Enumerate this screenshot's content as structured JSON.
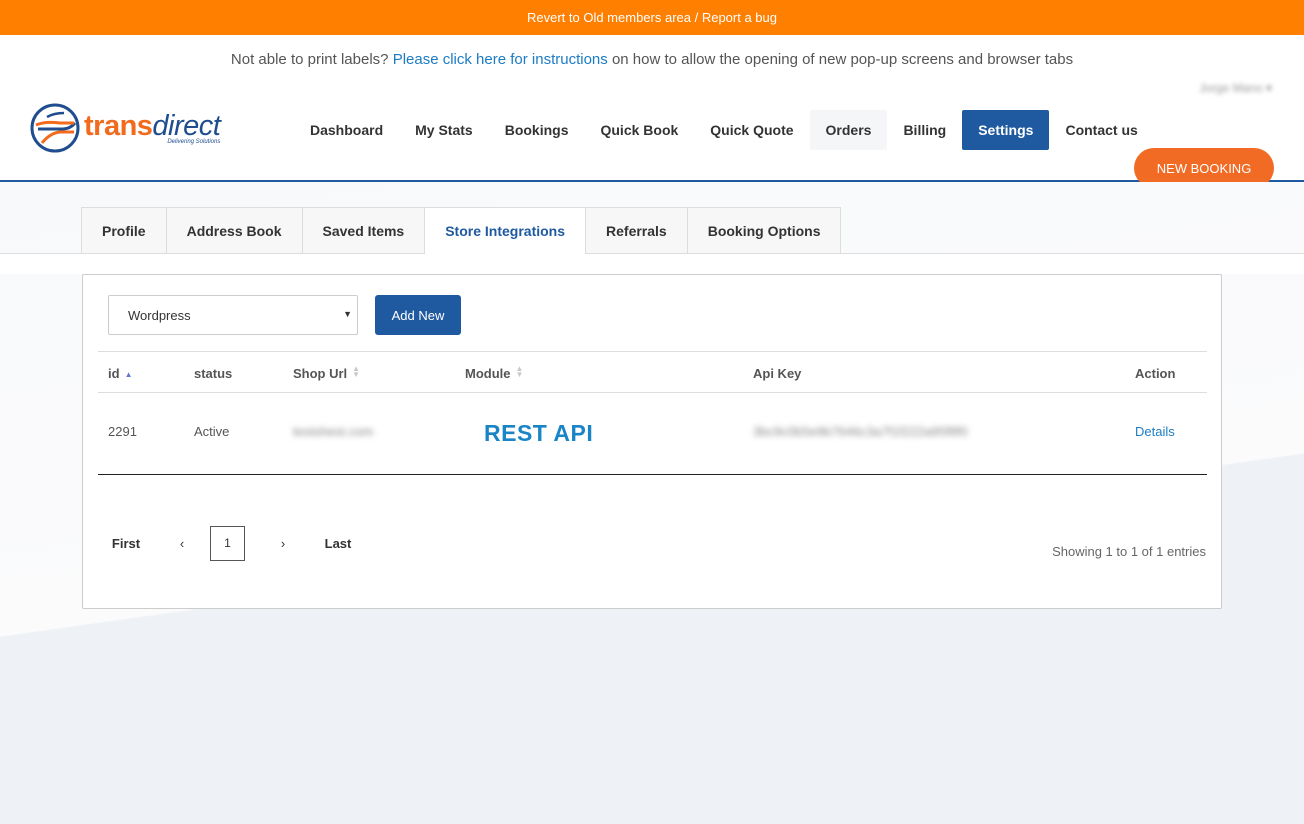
{
  "banner": {
    "text": "Revert to Old members area / Report a bug"
  },
  "notice": {
    "before": "Not able to print labels?",
    "link": "Please click here for instructions",
    "after": "on how to allow the opening of new pop-up screens and browser tabs"
  },
  "user": {
    "name": "Jorge Mano"
  },
  "logo": {
    "word_trans": "trans",
    "word_direct": "direct",
    "tagline": "Delivering Solutions"
  },
  "nav": {
    "items": [
      {
        "label": "Dashboard"
      },
      {
        "label": "My Stats"
      },
      {
        "label": "Bookings"
      },
      {
        "label": "Quick Book"
      },
      {
        "label": "Quick Quote"
      },
      {
        "label": "Orders"
      },
      {
        "label": "Billing"
      },
      {
        "label": "Settings"
      },
      {
        "label": "Contact us"
      }
    ],
    "new_booking": "NEW BOOKING"
  },
  "tabs": [
    {
      "label": "Profile"
    },
    {
      "label": "Address Book"
    },
    {
      "label": "Saved Items"
    },
    {
      "label": "Store Integrations"
    },
    {
      "label": "Referrals"
    },
    {
      "label": "Booking Options"
    }
  ],
  "controls": {
    "select_value": "Wordpress",
    "add_label": "Add New"
  },
  "table": {
    "headers": {
      "id": "id",
      "status": "status",
      "shop_url": "Shop Url",
      "module": "Module",
      "api_key": "Api Key",
      "action": "Action"
    },
    "rows": [
      {
        "id": "2291",
        "status": "Active",
        "shop_url": "testshest.com",
        "module": "REST API",
        "api_key": "3bc9c0b5e9b7646c3a7f1f222a95f8f0",
        "action": "Details"
      }
    ]
  },
  "pagination": {
    "first": "First",
    "prev": "‹",
    "page": "1",
    "next": "›",
    "last": "Last",
    "info": "Showing 1 to 1 of 1 entries"
  },
  "colors": {
    "banner": "#ff7f00",
    "primary": "#1f5aa0",
    "accent": "#f26b24",
    "link": "#1c7cc4"
  }
}
